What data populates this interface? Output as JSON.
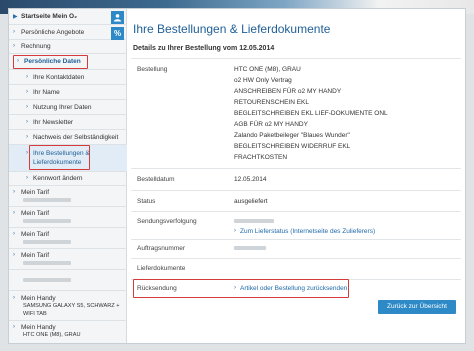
{
  "sidebar": {
    "start_label": "Startseite Mein O₂",
    "offers_label": "Persönliche Angebote",
    "invoice_label": "Rechnung",
    "personal_label": "Persönliche Daten",
    "sub_items": [
      "Ihre Kontaktdaten",
      "Ihr Name",
      "Nutzung Ihrer Daten",
      "Ihr Newsletter",
      "Nachweis der Selbständigkeit"
    ],
    "orders_line1": "Ihre Bestellungen &",
    "orders_line2": "Lieferdokumente",
    "password_label": "Kennwort ändern",
    "tariffs": [
      "Mein Tarif",
      "Mein Tarif",
      "Mein Tarif",
      "Mein Tarif"
    ],
    "handy1_label": "Mein Handy",
    "handy1_line1": "SAMSUNG GALAXY S5, SCHWARZ +",
    "handy1_line2": "WIFI TAB",
    "handy2_label": "Mein Handy",
    "handy2_line1": "HTC ONE (M8), GRAU",
    "user_icon": "user-icon",
    "percent_glyph": "%"
  },
  "main": {
    "title": "Ihre Bestellungen & Lieferdokumente",
    "subtitle": "Details zu Ihrer Bestellung vom 12.05.2014",
    "bestellung_label": "Bestellung",
    "items": [
      "HTC ONE (M8), GRAU",
      "o2 HW Only Vertrag",
      "ANSCHREIBEN FÜR o2 MY HANDY",
      "RETOURENSCHEIN EKL",
      "BEGLEITSCHREIBEN EKL LIEF-DOKUMENTE ONL",
      "AGB FÜR o2 MY HANDY",
      "Zalando Paketbeileger \"Blaues Wunder\"",
      "BEGLEITSCHREIBEN WIDERRUF EKL",
      "FRACHTKOSTEN"
    ],
    "bestelldatum_label": "Bestelldatum",
    "bestelldatum_value": "12.05.2014",
    "status_label": "Status",
    "status_value": "ausgeliefert",
    "tracking_label": "Sendungsverfolgung",
    "tracking_link": "Zum Lieferstatus (Internetseite des Zulieferers)",
    "auftrag_label": "Auftragsnummer",
    "lieferdok_label": "Lieferdokumente",
    "ruecksendung_label": "Rücksendung",
    "ruecksendung_link": "Artikel oder Bestellung zurücksenden",
    "back_button": "Zurück zur Übersicht"
  }
}
